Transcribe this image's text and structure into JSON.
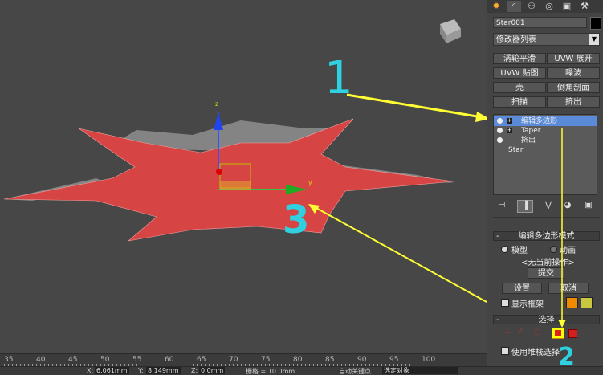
{
  "viewport": {
    "ruler_ticks": [
      "35",
      "40",
      "45",
      "50",
      "55",
      "60",
      "65",
      "70",
      "75",
      "80",
      "85",
      "90",
      "95",
      "100"
    ],
    "axis_y_label": "y",
    "axis_z_label": "z"
  },
  "annotations": {
    "one": "1",
    "two": "2",
    "three": "3"
  },
  "command_panel": {
    "tabs": [
      "✹",
      "◜",
      "⚇",
      "◎",
      "▣",
      "⚒"
    ],
    "object_name": "Star001",
    "modifier_list": "修改器列表",
    "modifier_buttons": [
      "涡轮平滑",
      "UVW 展开",
      "UVW 贴图",
      "噪波",
      "壳",
      "倒角剖面",
      "扫描",
      "挤出"
    ],
    "stack": [
      {
        "label": "编辑多边形",
        "selected": true
      },
      {
        "label": "Taper",
        "selected": false
      },
      {
        "label": "挤出",
        "selected": false
      },
      {
        "label": "Star",
        "selected": false
      }
    ],
    "stack_tools": [
      "⊣",
      "▐",
      "⋁",
      "◕",
      "▣"
    ],
    "edit_poly": {
      "title": "编辑多边形模式",
      "model": "模型",
      "animate": "动画",
      "no_op": "<无当前操作>",
      "commit": "提交",
      "settings": "设置",
      "cancel": "取消",
      "show_cage": "显示框架",
      "cage_color_1": "#f08a00",
      "cage_color_2": "#c8c840"
    },
    "selection": {
      "title": "选择",
      "use_stack": "使用堆栈选择"
    }
  },
  "statusbar": {
    "x_label": "X:",
    "x_value": "6.061mm",
    "y_label": "Y:",
    "y_value": "8.149mm",
    "z_label": "Z:",
    "z_value": "0.0mm",
    "grid": "栅格 = 10.0mm",
    "autokey": "自动关键点",
    "selected_obj": "选定对象"
  },
  "colors": {
    "star_fill": "#d64444",
    "arrow_yellow": "#ffff33",
    "annotation_cyan": "#2fd1e0",
    "highlight_box": "#ffff00"
  }
}
